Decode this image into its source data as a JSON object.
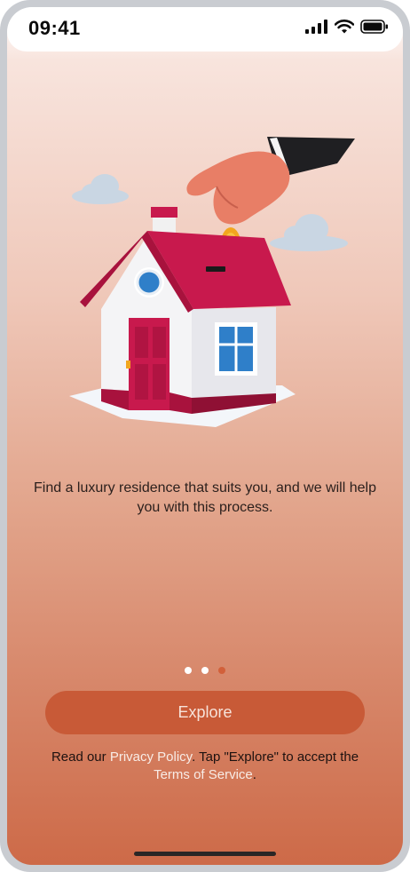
{
  "status_bar": {
    "time": "09:41",
    "icons": [
      "cellular-signal-icon",
      "wifi-icon",
      "battery-icon"
    ]
  },
  "onboarding": {
    "illustration": "house-coin-piggy-bank-illustration",
    "headline": "Find a luxury residence that suits you, and we will help you with this process.",
    "pager": {
      "total": 3,
      "active_index": 2
    }
  },
  "actions": {
    "explore_label": "Explore"
  },
  "legal": {
    "prefix": "Read our ",
    "privacy_link": "Privacy Policy",
    "middle": ". Tap \"Explore\" to accept the ",
    "terms_link": "Terms of Service",
    "suffix": "."
  },
  "colors": {
    "accent": "#c85a37",
    "active_dot": "#d2603a",
    "text": "#2a1f1c"
  }
}
